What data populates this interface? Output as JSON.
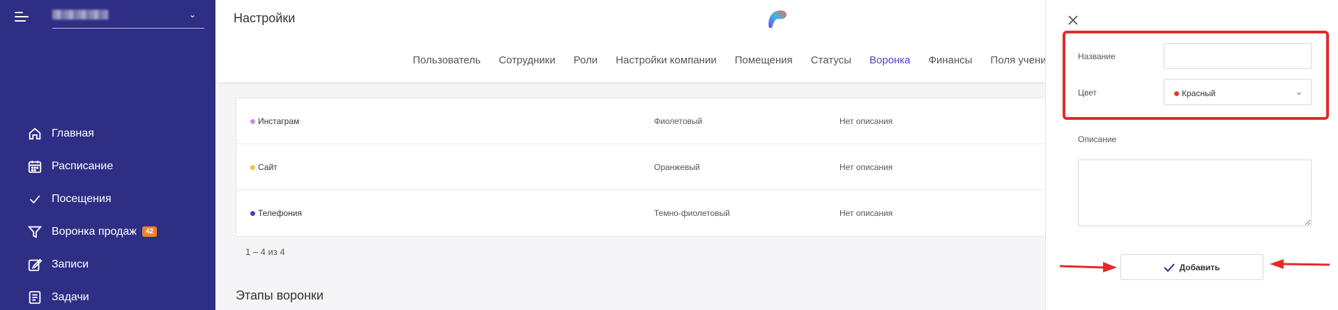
{
  "sidebar": {
    "items": [
      {
        "label": "Главная",
        "icon": "home-icon"
      },
      {
        "label": "Расписание",
        "icon": "calendar-icon"
      },
      {
        "label": "Посещения",
        "icon": "check-icon"
      },
      {
        "label": "Воронка продаж",
        "icon": "funnel-icon",
        "badge": "42"
      },
      {
        "label": "Записи",
        "icon": "edit-note-icon"
      },
      {
        "label": "Задачи",
        "icon": "task-list-icon"
      }
    ]
  },
  "header": {
    "title": "Настройки",
    "tabs": [
      "Пользователь",
      "Сотрудники",
      "Роли",
      "Настройки компании",
      "Помещения",
      "Статусы",
      "Воронка",
      "Финансы",
      "Поля учеников"
    ],
    "active_tab": "Воронка"
  },
  "sources_table": {
    "rows": [
      {
        "name": "Инстаграм",
        "color": "Фиолетовый",
        "dot": "#c88fe0",
        "description": "Нет описания"
      },
      {
        "name": "Сайт",
        "color": "Оранжевый",
        "dot": "#f4c14a",
        "description": "Нет описания"
      },
      {
        "name": "Телефония",
        "color": "Темно-фиолетовый",
        "dot": "#5a36b0",
        "description": "Нет описания"
      }
    ],
    "pagination": "1 – 4 из 4"
  },
  "stages_section": {
    "title": "Этапы воронки"
  },
  "form": {
    "name_label": "Название",
    "name_value": "",
    "color_label": "Цвет",
    "color_value": "Красный",
    "color_dot": "#e23a2a",
    "description_label": "Описание",
    "description_value": "",
    "submit_label": "Добавить"
  },
  "colors": {
    "sidebar": "#2f2e85",
    "accent": "#4b44c8",
    "annotation": "#e22a2a"
  }
}
